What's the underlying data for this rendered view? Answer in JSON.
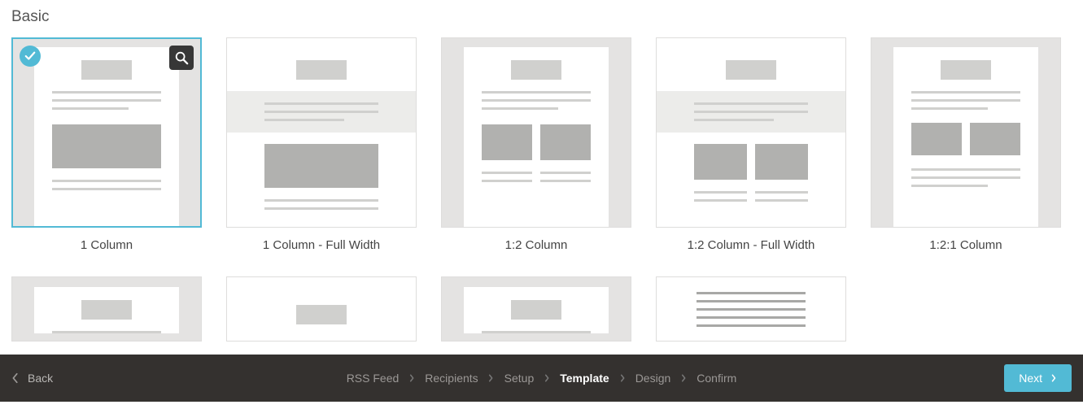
{
  "section_title": "Basic",
  "templates": [
    {
      "label": "1 Column",
      "selected": true
    },
    {
      "label": "1 Column - Full Width",
      "selected": false
    },
    {
      "label": "1:2 Column",
      "selected": false
    },
    {
      "label": "1:2 Column - Full Width",
      "selected": false
    },
    {
      "label": "1:2:1 Column",
      "selected": false
    }
  ],
  "footer": {
    "back_label": "Back",
    "next_label": "Next",
    "steps": [
      {
        "label": "RSS Feed",
        "active": false
      },
      {
        "label": "Recipients",
        "active": false
      },
      {
        "label": "Setup",
        "active": false
      },
      {
        "label": "Template",
        "active": true
      },
      {
        "label": "Design",
        "active": false
      },
      {
        "label": "Confirm",
        "active": false
      }
    ]
  },
  "icons": {
    "check": "check-icon",
    "zoom": "search-icon",
    "chevron_left": "chevron-left-icon",
    "chevron_right": "chevron-right-icon"
  },
  "colors": {
    "accent": "#52bad5",
    "bar": "#34312f"
  }
}
